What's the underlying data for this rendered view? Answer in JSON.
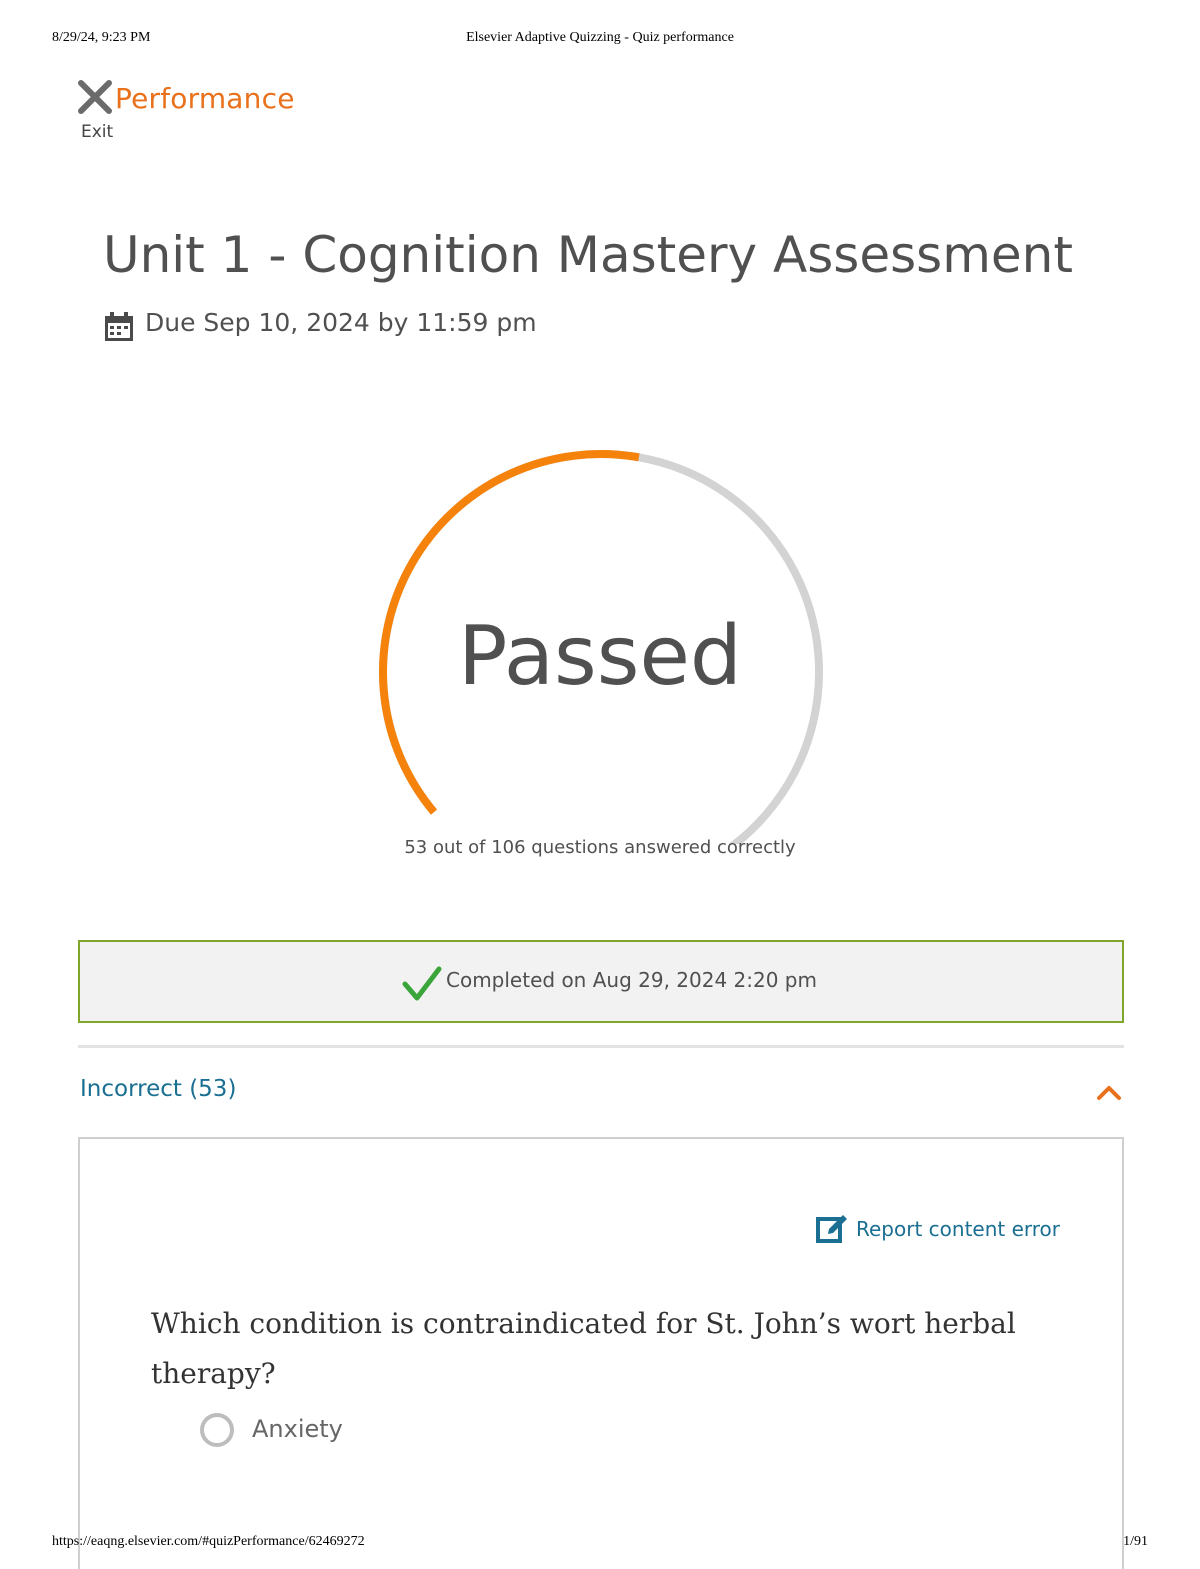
{
  "print_header": {
    "datetime": "8/29/24, 9:23 PM",
    "page_title": "Elsevier Adaptive Quizzing - Quiz performance"
  },
  "print_footer": {
    "url": "https://eaqng.elsevier.com/#quizPerformance/62469272",
    "page_number": "1/91"
  },
  "header": {
    "exit_label": "Exit",
    "exit_icon": "close-icon",
    "page_heading": "Performance",
    "accent_color": "#e9711c"
  },
  "quiz": {
    "title": "Unit 1 - Cognition Mastery Assessment",
    "due_icon": "calendar-icon",
    "due_text": "Due Sep 10, 2024 by 11:59 pm"
  },
  "result": {
    "status": "Passed",
    "correct": 53,
    "total": 106,
    "progress_fraction": 0.5,
    "score_text": "53 out of 106 questions answered correctly",
    "progress_color": "#f5820b",
    "track_color": "#d3d3d3"
  },
  "completion": {
    "icon": "checkmark-icon",
    "text": "Completed on Aug 29, 2024 2:20 pm",
    "border_color": "#7fa52a"
  },
  "incorrect_section": {
    "title": "Incorrect (53)",
    "expanded": true,
    "toggle_icon": "chevron-up-icon"
  },
  "question": {
    "report_label": "Report content error",
    "report_icon": "edit-icon",
    "text": "Which condition is contraindicated for St. John’s wort herbal therapy?",
    "options": [
      {
        "label": "Anxiety"
      }
    ]
  }
}
